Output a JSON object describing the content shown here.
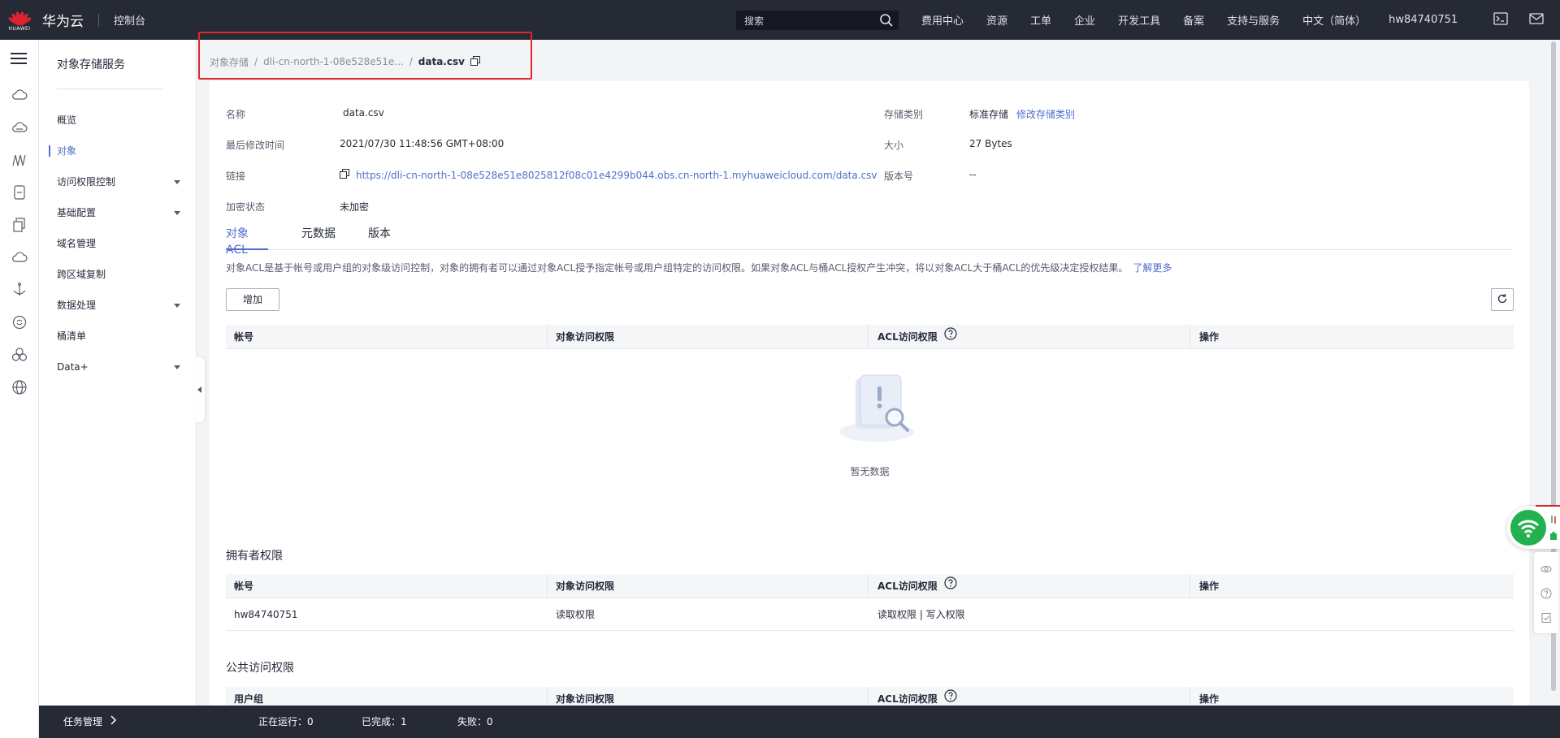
{
  "topbar": {
    "brand_mini": "HUAWEI",
    "brand": "华为云",
    "console": "控制台",
    "search_placeholder": "搜索",
    "nav": [
      "费用中心",
      "资源",
      "工单",
      "企业",
      "开发工具",
      "备案",
      "支持与服务",
      "中文（简体）",
      "hw84740751"
    ]
  },
  "rail": {
    "icons": [
      "cloud-icon",
      "cloud-drive-icon",
      "network-icon",
      "document-icon",
      "copy-icon",
      "cloud-upload-icon",
      "anchor-icon",
      "sync-icon",
      "cluster-icon",
      "globe-icon"
    ]
  },
  "sidebar": {
    "title": "对象存储服务",
    "items": [
      {
        "label": "概览",
        "caret": false,
        "active": false
      },
      {
        "label": "对象",
        "caret": false,
        "active": true
      },
      {
        "label": "访问权限控制",
        "caret": true,
        "active": false
      },
      {
        "label": "基础配置",
        "caret": true,
        "active": false
      },
      {
        "label": "域名管理",
        "caret": false,
        "active": false
      },
      {
        "label": "跨区域复制",
        "caret": false,
        "active": false
      },
      {
        "label": "数据处理",
        "caret": true,
        "active": false
      },
      {
        "label": "桶清单",
        "caret": false,
        "active": false
      },
      {
        "label": "Data+",
        "caret": true,
        "active": false
      }
    ]
  },
  "breadcrumb": {
    "root": "对象存储",
    "bucket": "dli-cn-north-1-08e528e51e...",
    "current": "data.csv"
  },
  "properties": {
    "name_label": "名称",
    "name_value": "data.csv",
    "modified_label": "最后修改时间",
    "modified_value": "2021/07/30 11:48:56 GMT+08:00",
    "link_label": "链接",
    "link_value": "https://dli-cn-north-1-08e528e51e8025812f08c01e4299b044.obs.cn-north-1.myhuaweicloud.com/data.csv",
    "encryption_label": "加密状态",
    "encryption_value": "未加密",
    "storage_label": "存储类别",
    "storage_value": "标准存储",
    "storage_change": "修改存储类别",
    "size_label": "大小",
    "size_value": "27 Bytes",
    "version_label": "版本号",
    "version_value": "--"
  },
  "tabs": [
    "对象ACL",
    "元数据",
    "版本"
  ],
  "description": "对象ACL是基于帐号或用户组的对象级访问控制，对象的拥有者可以通过对象ACL授予指定帐号或用户组特定的访问权限。如果对象ACL与桶ACL授权产生冲突，将以对象ACL大于桶ACL的优先级决定授权结果。",
  "learn_more": "了解更多",
  "add_button": "增加",
  "acl_table": {
    "columns": [
      "帐号",
      "对象访问权限",
      "ACL访问权限",
      "操作"
    ],
    "empty_text": "暂无数据"
  },
  "owner_section": {
    "title": "拥有者权限",
    "columns": [
      "帐号",
      "对象访问权限",
      "ACL访问权限",
      "操作"
    ],
    "rows": [
      {
        "account": "hw84740751",
        "object_access": "读取权限",
        "acl_access": "读取权限 | 写入权限",
        "action": ""
      }
    ]
  },
  "public_section": {
    "title": "公共访问权限",
    "columns": [
      "用户组",
      "对象访问权限",
      "ACL访问权限",
      "操作"
    ]
  },
  "taskbar": {
    "title": "任务管理",
    "running_label": "正在运行：",
    "running_value": "0",
    "completed_label": "已完成：",
    "completed_value": "1",
    "failed_label": "失败：",
    "failed_value": "0"
  },
  "colors": {
    "topbar": "#262a35",
    "accent": "#526ecc",
    "highlight": "#e0262e",
    "huawei_red": "#e0222e",
    "widget_green": "#23b14d"
  }
}
